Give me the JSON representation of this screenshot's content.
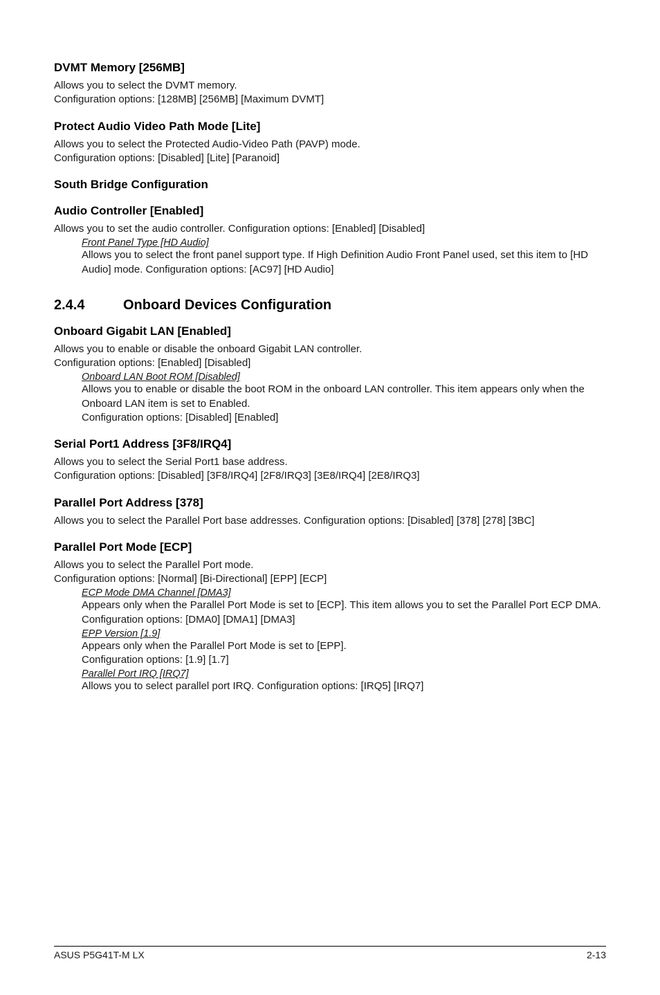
{
  "dvmt": {
    "heading": "DVMT Memory [256MB]",
    "line1": "Allows you to select the DVMT memory.",
    "line2": "Configuration options: [128MB] [256MB] [Maximum DVMT]"
  },
  "pavp": {
    "heading": "Protect Audio Video Path Mode [Lite]",
    "line1": "Allows you to select the Protected Audio-Video Path (PAVP) mode.",
    "line2": "Configuration options: [Disabled] [Lite] [Paranoid]"
  },
  "sbridge": {
    "heading": "South Bridge Configuration"
  },
  "audio": {
    "heading": "Audio Controller [Enabled]",
    "line1": "Allows you to set the audio controller. Configuration options: [Enabled] [Disabled]",
    "sub1_title": "Front Panel Type [HD Audio]",
    "sub1_desc": "Allows you to select the front panel support type. If High Definition Audio Front Panel used, set this item to [HD Audio] mode. Configuration options: [AC97] [HD Audio]"
  },
  "section": {
    "num": "2.4.4",
    "title": "Onboard Devices Configuration"
  },
  "lan": {
    "heading": "Onboard Gigabit LAN [Enabled]",
    "line1": "Allows you to enable or disable the onboard Gigabit LAN controller.",
    "line2": "Configuration options: [Enabled] [Disabled]",
    "sub1_title": "Onboard LAN Boot ROM [Disabled]",
    "sub1_desc1": "Allows you to enable or disable the boot ROM in the onboard LAN controller. This item appears only when the Onboard LAN item is set to Enabled.",
    "sub1_desc2": "Configuration options: [Disabled] [Enabled]"
  },
  "serial": {
    "heading": "Serial Port1 Address [3F8/IRQ4]",
    "line1": "Allows you to select the Serial Port1 base address.",
    "line2": "Configuration options: [Disabled] [3F8/IRQ4] [2F8/IRQ3] [3E8/IRQ4] [2E8/IRQ3]"
  },
  "paddr": {
    "heading": "Parallel Port Address [378]",
    "line1": "Allows you to select the Parallel Port base addresses. Configuration options: [Disabled] [378] [278] [3BC]"
  },
  "pmode": {
    "heading": "Parallel Port Mode [ECP]",
    "line1": "Allows you to select the Parallel Port mode.",
    "line2": "Configuration options: [Normal] [Bi-Directional] [EPP] [ECP]",
    "sub1_title": "ECP Mode DMA Channel [DMA3]",
    "sub1_desc": "Appears only when the Parallel Port Mode is set to [ECP]. This item allows you to set the Parallel Port ECP DMA. Configuration options: [DMA0] [DMA1] [DMA3]",
    "sub2_title": "EPP Version [1.9]",
    "sub2_desc1": "Appears only when the Parallel Port Mode is set to [EPP].",
    "sub2_desc2": "Configuration options: [1.9] [1.7]",
    "sub3_title": "Parallel Port IRQ [IRQ7]",
    "sub3_desc": "Allows you to select parallel port IRQ. Configuration options: [IRQ5] [IRQ7]"
  },
  "footer": {
    "left": "ASUS P5G41T-M LX",
    "right": "2-13"
  }
}
